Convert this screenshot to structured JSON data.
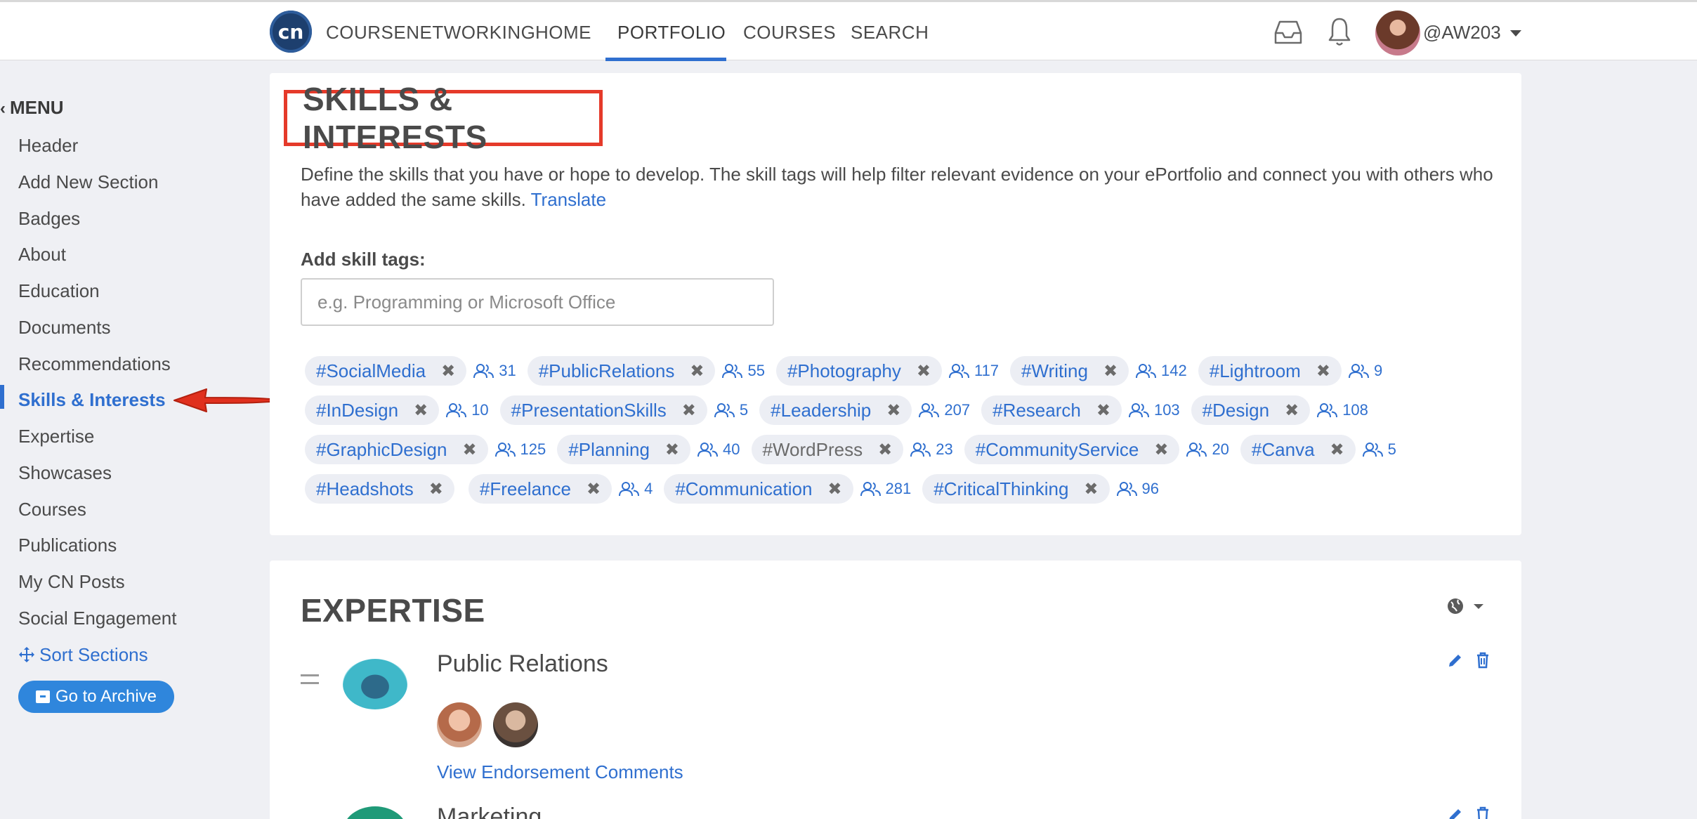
{
  "nav": {
    "logo": "cn",
    "brand": "COURSENETWORKING",
    "items": [
      {
        "label": "HOME"
      },
      {
        "label": "PORTFOLIO"
      },
      {
        "label": "COURSES"
      },
      {
        "label": "SEARCH"
      }
    ],
    "active": "PORTFOLIO",
    "username": "@AW203"
  },
  "sidebar": {
    "menu_title": "MENU",
    "items": [
      {
        "label": "Header"
      },
      {
        "label": "Add New Section"
      },
      {
        "label": "Badges"
      },
      {
        "label": "About"
      },
      {
        "label": "Education"
      },
      {
        "label": "Documents"
      },
      {
        "label": "Recommendations"
      },
      {
        "label": "Skills & Interests"
      },
      {
        "label": "Expertise"
      },
      {
        "label": "Showcases"
      },
      {
        "label": "Courses"
      },
      {
        "label": "Publications"
      },
      {
        "label": "My CN Posts"
      },
      {
        "label": "Social Engagement"
      }
    ],
    "active": "Skills & Interests",
    "sort_label": "Sort Sections",
    "archive_label": "Go to Archive"
  },
  "skills": {
    "title": "SKILLS & INTERESTS",
    "description": "Define the skills that you have or hope to develop. The skill tags will help filter relevant evidence on your ePortfolio and connect you with others who have added the same skills.",
    "translate": "Translate",
    "add_label": "Add skill tags:",
    "input_placeholder": "e.g. Programming or Microsoft Office",
    "tags": [
      {
        "label": "#SocialMedia",
        "count": "31"
      },
      {
        "label": "#PublicRelations",
        "count": "55"
      },
      {
        "label": "#Photography",
        "count": "117"
      },
      {
        "label": "#Writing",
        "count": "142"
      },
      {
        "label": "#Lightroom",
        "count": "9"
      },
      {
        "label": "#InDesign",
        "count": "10"
      },
      {
        "label": "#PresentationSkills",
        "count": "5"
      },
      {
        "label": "#Leadership",
        "count": "207"
      },
      {
        "label": "#Research",
        "count": "103"
      },
      {
        "label": "#Design",
        "count": "108"
      },
      {
        "label": "#GraphicDesign",
        "count": "125"
      },
      {
        "label": "#Planning",
        "count": "40"
      },
      {
        "label": "#WordPress",
        "count": "23"
      },
      {
        "label": "#CommunityService",
        "count": "20"
      },
      {
        "label": "#Canva",
        "count": "5"
      },
      {
        "label": "#Headshots",
        "count": ""
      },
      {
        "label": "#Freelance",
        "count": "4"
      },
      {
        "label": "#Communication",
        "count": "281"
      },
      {
        "label": "#CriticalThinking",
        "count": "96"
      }
    ]
  },
  "expertise": {
    "title": "EXPERTISE",
    "items": [
      {
        "name": "Public Relations",
        "link": "View Endorsement Comments"
      },
      {
        "name": "Marketing"
      }
    ]
  },
  "colors": {
    "accent": "#2f6fcf",
    "highlight_box": "#e53a2a",
    "arrow": "#e0301e",
    "background": "#eff0f4",
    "archive_button": "#2f86dc"
  },
  "icons": [
    "inbox-icon",
    "bell-icon",
    "chevron-left-icon",
    "move-arrows-icon",
    "archive-icon",
    "users-icon",
    "close-icon",
    "globe-icon",
    "pencil-icon",
    "trash-icon",
    "drag-handle-icon"
  ]
}
